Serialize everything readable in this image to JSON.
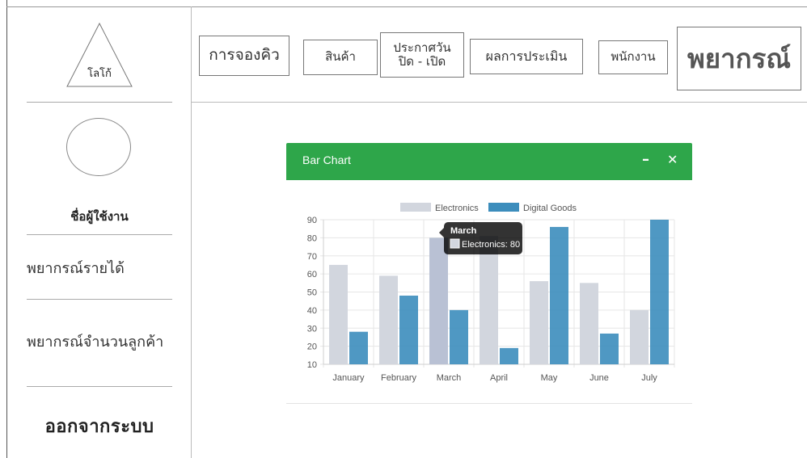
{
  "sidebar": {
    "logo_label": "โลโก้",
    "username": "ชื่อผู้ใช้งาน",
    "menu": [
      {
        "label": "พยากรณ์รายได้"
      },
      {
        "label": "พยากรณ์จำนวนลูกค้า"
      }
    ],
    "logout": "ออกจากระบบ"
  },
  "topnav": {
    "items": [
      {
        "label": "การจองคิว"
      },
      {
        "label": "สินค้า"
      },
      {
        "label": "ประกาศวัน\nปิด - เปิด"
      },
      {
        "label": "ผลการประเมิน"
      },
      {
        "label": "พนักงาน"
      },
      {
        "label": "พยากรณ์"
      }
    ]
  },
  "panel": {
    "title": "Bar Chart",
    "minimize_icon": "minus-icon",
    "close_icon": "close-icon",
    "header_color": "#2ea64a"
  },
  "chart_data": {
    "type": "bar",
    "categories": [
      "January",
      "February",
      "March",
      "April",
      "May",
      "June",
      "July"
    ],
    "series": [
      {
        "name": "Electronics",
        "color": "#d2d6de",
        "values": [
          65,
          59,
          80,
          81,
          56,
          55,
          40
        ]
      },
      {
        "name": "Digital Goods",
        "color": "#3c8dbc",
        "values": [
          28,
          48,
          40,
          19,
          86,
          27,
          90
        ]
      }
    ],
    "ylim": [
      10,
      90
    ],
    "yticks": [
      10,
      20,
      30,
      40,
      50,
      60,
      70,
      80,
      90
    ],
    "grid": true,
    "legend_position": "top",
    "tooltip": {
      "title": "March",
      "text": "Electronics: 80"
    }
  }
}
